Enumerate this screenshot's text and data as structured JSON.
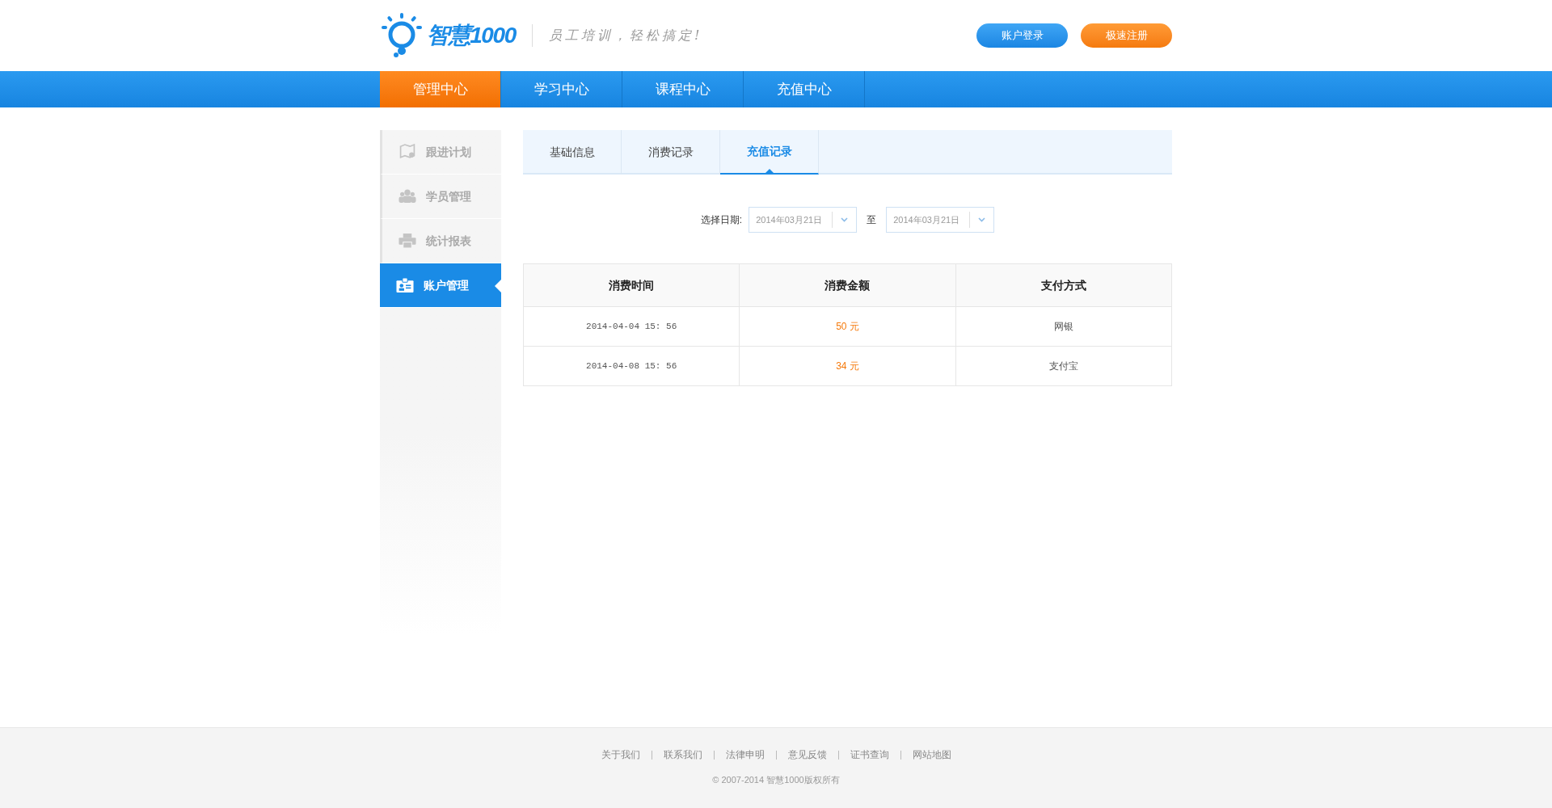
{
  "header": {
    "logo_text": "智慧1000",
    "slogan": "员工培训，轻松搞定!",
    "buttons": [
      {
        "label": "账户登录",
        "kind": "login"
      },
      {
        "label": "极速注册",
        "kind": "register"
      }
    ]
  },
  "nav": [
    {
      "label": "管理中心",
      "selected": true
    },
    {
      "label": "学习中心",
      "selected": false
    },
    {
      "label": "课程中心",
      "selected": false
    },
    {
      "label": "充值中心",
      "selected": false
    }
  ],
  "sidebar": [
    {
      "label": "跟进计划",
      "kind": "map",
      "selected": false
    },
    {
      "label": "学员管理",
      "kind": "people",
      "selected": false
    },
    {
      "label": "统计报表",
      "kind": "printer",
      "selected": false
    },
    {
      "label": "账户管理",
      "kind": "card",
      "selected": true
    }
  ],
  "tabs": [
    {
      "label": "基础信息",
      "selected": false
    },
    {
      "label": "消费记录",
      "selected": false
    },
    {
      "label": "充值记录",
      "selected": true
    }
  ],
  "date_filter": {
    "label": "选择日期:",
    "from": "2014年03月21日",
    "separator": "至",
    "to": "2014年03月21日"
  },
  "table": {
    "columns": [
      "消费时间",
      "消费金额",
      "支付方式"
    ],
    "rows": [
      [
        "2014-04-04 15: 56",
        "50 元",
        "网银"
      ],
      [
        "2014-04-08 15: 56",
        "34 元",
        "支付宝"
      ]
    ]
  },
  "footer": {
    "links": [
      "关于我们",
      "联系我们",
      "法律申明",
      "意见反馈",
      "证书查询",
      "网站地图"
    ],
    "copyright": "© 2007-2014 智慧1000版权所有"
  }
}
